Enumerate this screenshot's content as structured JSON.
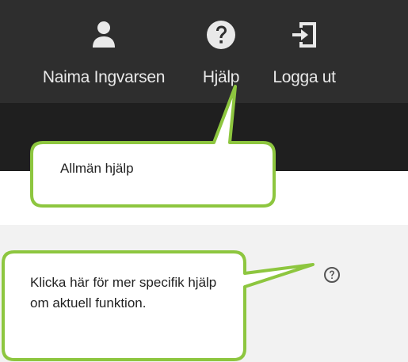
{
  "header": {
    "user": {
      "name": "Naima Ingvarsen",
      "icon": "user-icon"
    },
    "help": {
      "label": "Hjälp",
      "icon": "question-circle-icon"
    },
    "logout": {
      "label": "Logga ut",
      "icon": "sign-out-icon"
    }
  },
  "callouts": {
    "general": "Allmän hjälp",
    "specific": "Klicka här för mer specifik hjälp om aktuell funktion."
  },
  "panel": {
    "help_icon": "question-circle-outline-icon"
  },
  "colors": {
    "topbar": "#2e2e2e",
    "subbar": "#1f1f1f",
    "callout_border": "#8dc63f",
    "panel": "#f2f2f2"
  }
}
